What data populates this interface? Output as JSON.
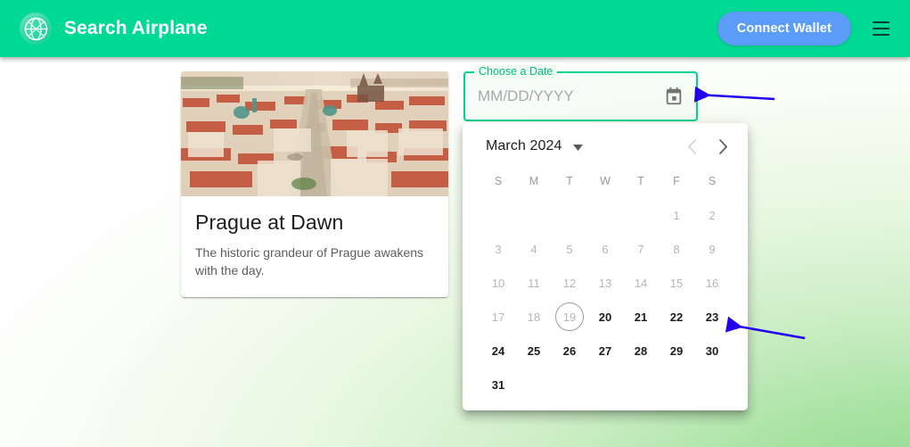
{
  "header": {
    "logo_icon": "globe-network-icon",
    "title": "Search Airplane",
    "connect_wallet_label": "Connect Wallet",
    "menu_icon": "hamburger-menu-icon",
    "brand_color": "#00d993",
    "wallet_button_color": "#5a9cf8"
  },
  "card": {
    "image_alt": "Aerial view of Prague old town at dawn",
    "title": "Prague at Dawn",
    "description": "The historic grandeur of Prague awakens with the day."
  },
  "date_field": {
    "label": "Choose a Date",
    "placeholder": "MM/DD/YYYY",
    "value": "",
    "calendar_icon": "calendar-icon",
    "outline_color": "#00d28f"
  },
  "calendar": {
    "month_label": "March 2024",
    "dropdown_icon": "chevron-down-icon",
    "prev_icon": "chevron-left-icon",
    "next_icon": "chevron-right-icon",
    "prev_enabled": false,
    "next_enabled": true,
    "weekdays": [
      "S",
      "M",
      "T",
      "W",
      "T",
      "F",
      "S"
    ],
    "weeks": [
      [
        {
          "day": "",
          "state": "empty"
        },
        {
          "day": "",
          "state": "empty"
        },
        {
          "day": "",
          "state": "empty"
        },
        {
          "day": "",
          "state": "empty"
        },
        {
          "day": "",
          "state": "empty"
        },
        {
          "day": "1",
          "state": "disabled"
        },
        {
          "day": "2",
          "state": "disabled"
        }
      ],
      [
        {
          "day": "3",
          "state": "disabled"
        },
        {
          "day": "4",
          "state": "disabled"
        },
        {
          "day": "5",
          "state": "disabled"
        },
        {
          "day": "6",
          "state": "disabled"
        },
        {
          "day": "7",
          "state": "disabled"
        },
        {
          "day": "8",
          "state": "disabled"
        },
        {
          "day": "9",
          "state": "disabled"
        }
      ],
      [
        {
          "day": "10",
          "state": "disabled"
        },
        {
          "day": "11",
          "state": "disabled"
        },
        {
          "day": "12",
          "state": "disabled"
        },
        {
          "day": "13",
          "state": "disabled"
        },
        {
          "day": "14",
          "state": "disabled"
        },
        {
          "day": "15",
          "state": "disabled"
        },
        {
          "day": "16",
          "state": "disabled"
        }
      ],
      [
        {
          "day": "17",
          "state": "disabled"
        },
        {
          "day": "18",
          "state": "disabled"
        },
        {
          "day": "19",
          "state": "today-disabled"
        },
        {
          "day": "20",
          "state": "enabled"
        },
        {
          "day": "21",
          "state": "enabled"
        },
        {
          "day": "22",
          "state": "enabled"
        },
        {
          "day": "23",
          "state": "enabled"
        }
      ],
      [
        {
          "day": "24",
          "state": "enabled"
        },
        {
          "day": "25",
          "state": "enabled"
        },
        {
          "day": "26",
          "state": "enabled"
        },
        {
          "day": "27",
          "state": "enabled"
        },
        {
          "day": "28",
          "state": "enabled"
        },
        {
          "day": "29",
          "state": "enabled"
        },
        {
          "day": "30",
          "state": "enabled"
        }
      ],
      [
        {
          "day": "31",
          "state": "enabled"
        },
        {
          "day": "",
          "state": "empty"
        },
        {
          "day": "",
          "state": "empty"
        },
        {
          "day": "",
          "state": "empty"
        },
        {
          "day": "",
          "state": "empty"
        },
        {
          "day": "",
          "state": "empty"
        },
        {
          "day": "",
          "state": "empty"
        }
      ]
    ]
  },
  "annotations": {
    "color": "#2200ee",
    "arrow_1_target": "calendar-icon",
    "arrow_2_target": "calendar-day-23"
  }
}
